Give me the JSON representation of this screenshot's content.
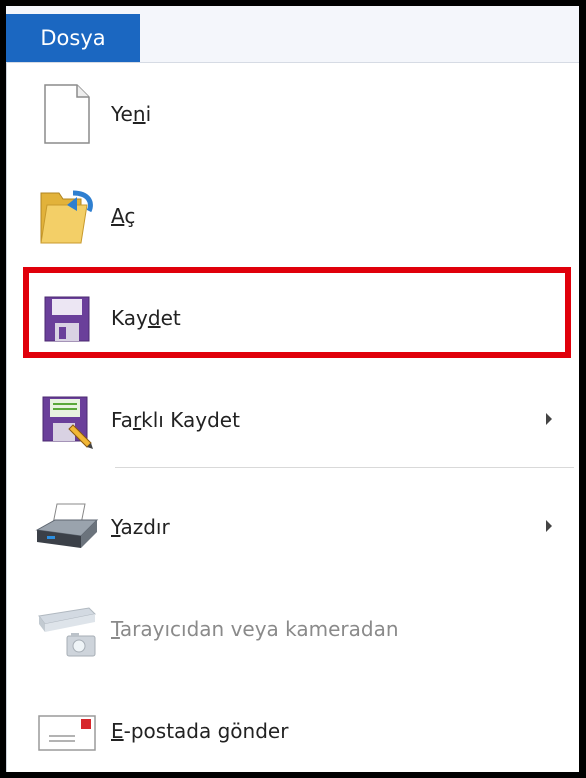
{
  "tab": {
    "label": "Dosya"
  },
  "menu": {
    "new": {
      "pre": "Ye",
      "acc": "n",
      "post": "i",
      "icon": "blank-document-icon"
    },
    "open": {
      "pre": "",
      "acc": "A",
      "post": "ç",
      "icon": "open-folder-icon"
    },
    "save": {
      "pre": "Kay",
      "acc": "d",
      "post": "et",
      "icon": "floppy-disk-icon"
    },
    "save_as": {
      "pre": "Fa",
      "acc": "r",
      "post": "klı Kaydet",
      "icon": "save-as-icon"
    },
    "print": {
      "pre": "",
      "acc": "Y",
      "post": "azdır",
      "icon": "printer-icon"
    },
    "scanner": {
      "pre": "",
      "acc": "T",
      "post": "arayıcıdan veya kameradan",
      "icon": "scanner-camera-icon"
    },
    "email": {
      "pre": "",
      "acc": "E",
      "post": "-postada gönder",
      "icon": "email-envelope-icon"
    }
  },
  "colors": {
    "tab_blue": "#1b67c1",
    "highlight_red": "#e0000b",
    "floppy_purple": "#6a3f9a"
  }
}
